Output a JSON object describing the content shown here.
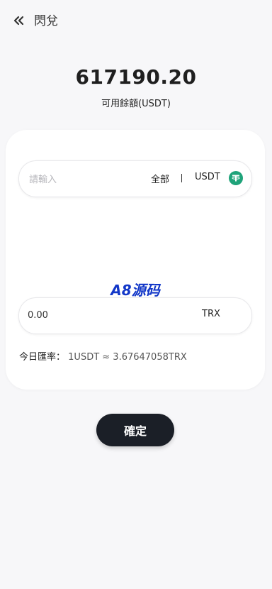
{
  "header": {
    "title": "閃兌",
    "back_icon": "chevrons-left-icon"
  },
  "balance": {
    "amount": "617190.20",
    "label": "可用餘額(USDT)"
  },
  "exchange": {
    "from": {
      "placeholder": "請輸入",
      "all_label": "全部",
      "currency": "USDT",
      "token_icon": "tether-icon",
      "token_color": "#1fa37a"
    },
    "to": {
      "amount": "0.00",
      "currency": "TRX"
    },
    "rate": {
      "label": "今日匯率：",
      "value": "1USDT ≈ 3.67647058TRX"
    }
  },
  "watermark": "A8源码",
  "actions": {
    "confirm_label": "確定"
  },
  "colors": {
    "page_bg": "#f7f7f9",
    "card_bg": "#ffffff",
    "button_bg": "#1b1f27",
    "watermark": "#1237c8"
  }
}
